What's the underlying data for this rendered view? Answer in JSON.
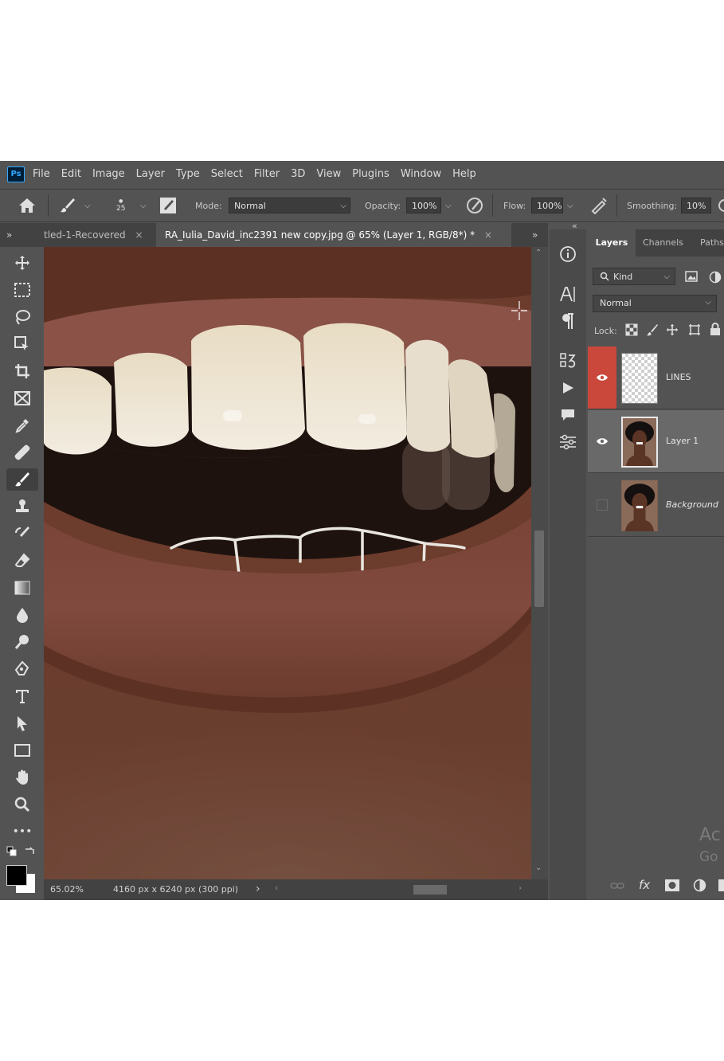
{
  "app": {
    "logo": "Ps"
  },
  "menu": [
    "File",
    "Edit",
    "Image",
    "Layer",
    "Type",
    "Select",
    "Filter",
    "3D",
    "View",
    "Plugins",
    "Window",
    "Help"
  ],
  "options": {
    "brush_size": "25",
    "mode_label": "Mode:",
    "mode_value": "Normal",
    "opacity_label": "Opacity:",
    "opacity_value": "100%",
    "flow_label": "Flow:",
    "flow_value": "100%",
    "smoothing_label": "Smoothing:",
    "smoothing_value": "10%"
  },
  "tabs": {
    "expand_left": "»",
    "tab1_label": "tled-1-Recovered",
    "tab2_label": "RA_Iulia_David_inc2391 new copy.jpg @ 65% (Layer 1, RGB/8*) *",
    "close": "×",
    "expand_right": "»",
    "collapse_right": "«"
  },
  "status": {
    "zoom": "65.02%",
    "doc_size": "4160 px x 6240 px (300 ppi)",
    "arrow": "›"
  },
  "layers_panel": {
    "tabs": [
      "Layers",
      "Channels",
      "Paths"
    ],
    "filter_label": "Kind",
    "blend_mode": "Normal",
    "lock_label": "Lock:",
    "layers": [
      {
        "name": "LINES",
        "visible": true,
        "selected": false
      },
      {
        "name": "Layer 1",
        "visible": true,
        "selected": true
      },
      {
        "name": "Background",
        "visible": false,
        "selected": false
      }
    ],
    "footer_fx": "fx"
  },
  "watermark": {
    "line1": "Ac",
    "line2": "Go"
  },
  "colors": {
    "ui_bg": "#535353",
    "panel_dark": "#424242",
    "eye_highlight": "#c9483b",
    "selected_row": "#696969"
  }
}
